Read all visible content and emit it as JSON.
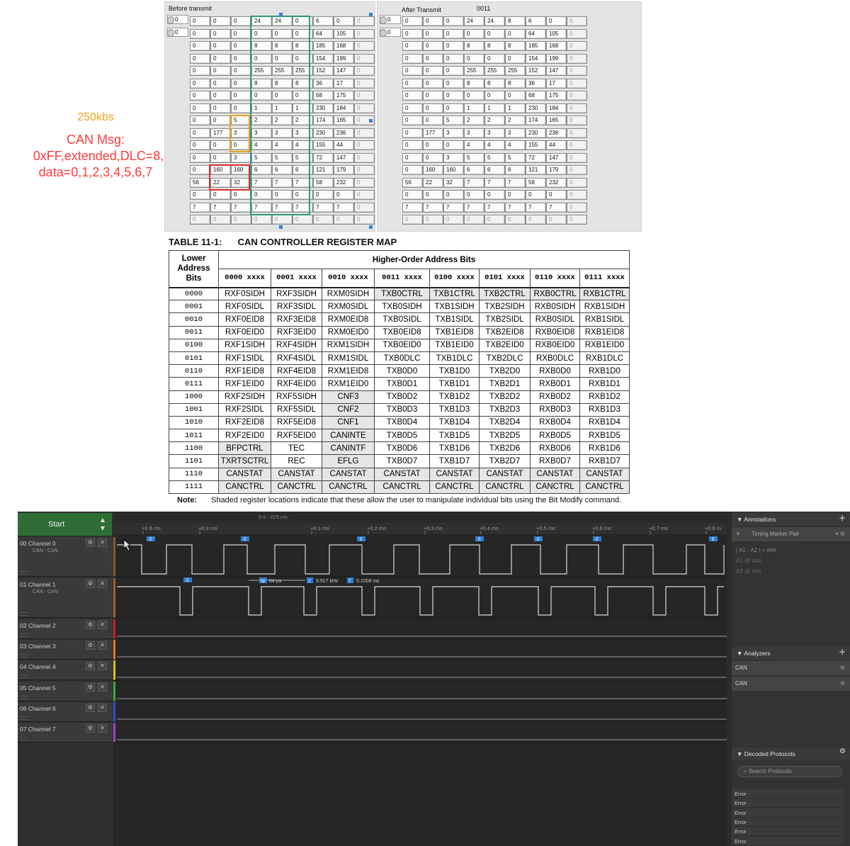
{
  "labview": {
    "before_label": "Before transmit",
    "after_label": "After Transmit",
    "after_extra": "0011",
    "ctl_values": [
      "0",
      "0"
    ],
    "before_rows": [
      [
        "0",
        "0",
        "0",
        "24",
        "24",
        "0",
        "6",
        "0",
        "0"
      ],
      [
        "0",
        "0",
        "0",
        "0",
        "0",
        "0",
        "64",
        "105",
        "0"
      ],
      [
        "0",
        "0",
        "0",
        "8",
        "8",
        "8",
        "185",
        "168",
        "0"
      ],
      [
        "0",
        "0",
        "0",
        "0",
        "0",
        "0",
        "154",
        "199",
        "0"
      ],
      [
        "0",
        "0",
        "0",
        "255",
        "255",
        "255",
        "152",
        "147",
        "0"
      ],
      [
        "0",
        "0",
        "0",
        "8",
        "8",
        "8",
        "36",
        "17",
        "0"
      ],
      [
        "0",
        "0",
        "0",
        "0",
        "0",
        "0",
        "68",
        "175",
        "0"
      ],
      [
        "0",
        "0",
        "0",
        "1",
        "1",
        "1",
        "230",
        "184",
        "0"
      ],
      [
        "0",
        "0",
        "5",
        "2",
        "2",
        "2",
        "174",
        "165",
        "0"
      ],
      [
        "0",
        "177",
        "3",
        "3",
        "3",
        "3",
        "230",
        "236",
        "0"
      ],
      [
        "0",
        "0",
        "0",
        "4",
        "4",
        "4",
        "155",
        "44",
        "0"
      ],
      [
        "0",
        "0",
        "3",
        "5",
        "5",
        "5",
        "72",
        "147",
        "0"
      ],
      [
        "0",
        "160",
        "160",
        "6",
        "6",
        "6",
        "121",
        "179",
        "0"
      ],
      [
        "56",
        "22",
        "32",
        "7",
        "7",
        "7",
        "58",
        "232",
        "0"
      ],
      [
        "0",
        "0",
        "0",
        "0",
        "0",
        "0",
        "0",
        "0",
        "0"
      ],
      [
        "7",
        "7",
        "7",
        "7",
        "7",
        "7",
        "7",
        "7",
        "0"
      ],
      [
        "0",
        "0",
        "0",
        "0",
        "0",
        "0",
        "0",
        "0",
        "0"
      ]
    ],
    "after_rows": [
      [
        "0",
        "0",
        "0",
        "24",
        "24",
        "8",
        "6",
        "0",
        "0"
      ],
      [
        "0",
        "0",
        "0",
        "0",
        "0",
        "0",
        "64",
        "105",
        "0"
      ],
      [
        "0",
        "0",
        "0",
        "8",
        "8",
        "8",
        "185",
        "168",
        "0"
      ],
      [
        "0",
        "0",
        "0",
        "0",
        "0",
        "0",
        "154",
        "199",
        "0"
      ],
      [
        "0",
        "0",
        "0",
        "255",
        "255",
        "255",
        "152",
        "147",
        "0"
      ],
      [
        "0",
        "0",
        "0",
        "8",
        "8",
        "8",
        "36",
        "17",
        "0"
      ],
      [
        "0",
        "0",
        "0",
        "0",
        "0",
        "0",
        "68",
        "175",
        "0"
      ],
      [
        "0",
        "0",
        "0",
        "1",
        "1",
        "1",
        "230",
        "184",
        "0"
      ],
      [
        "0",
        "0",
        "5",
        "2",
        "2",
        "2",
        "174",
        "165",
        "0"
      ],
      [
        "0",
        "177",
        "3",
        "3",
        "3",
        "3",
        "230",
        "236",
        "0"
      ],
      [
        "0",
        "0",
        "0",
        "4",
        "4",
        "4",
        "155",
        "44",
        "0"
      ],
      [
        "0",
        "0",
        "3",
        "5",
        "5",
        "5",
        "72",
        "147",
        "0"
      ],
      [
        "0",
        "160",
        "160",
        "6",
        "6",
        "6",
        "121",
        "179",
        "0"
      ],
      [
        "56",
        "22",
        "32",
        "7",
        "7",
        "7",
        "58",
        "232",
        "0"
      ],
      [
        "0",
        "0",
        "0",
        "0",
        "0",
        "0",
        "0",
        "0",
        "0"
      ],
      [
        "7",
        "7",
        "7",
        "7",
        "7",
        "7",
        "7",
        "7",
        "0"
      ],
      [
        "0",
        "0",
        "0",
        "0",
        "0",
        "0",
        "0",
        "0",
        "0"
      ]
    ]
  },
  "notes": {
    "speed": "250kbs",
    "msg_line1": "CAN Msg:",
    "msg_line2": "0xFF,extended,DLC=8,",
    "msg_line3": "data=0,1,2,3,4,5,6,7"
  },
  "register_map": {
    "table_number": "TABLE 11-1:",
    "title": "CAN CONTROLLER REGISTER MAP",
    "lower_header": "Lower Address Bits",
    "higher_header": "Higher-Order Address Bits",
    "columns": [
      "0000 xxxx",
      "0001 xxxx",
      "0010 xxxx",
      "0011 xxxx",
      "0100 xxxx",
      "0101 xxxx",
      "0110 xxxx",
      "0111 xxxx"
    ],
    "rows": [
      {
        "addr": "0000",
        "cells": [
          "RXF0SIDH",
          "RXF3SIDH",
          "RXM0SIDH",
          "TXB0CTRL",
          "TXB1CTRL",
          "TXB2CTRL",
          "RXB0CTRL",
          "RXB1CTRL"
        ]
      },
      {
        "addr": "0001",
        "cells": [
          "RXF0SIDL",
          "RXF3SIDL",
          "RXM0SIDL",
          "TXB0SIDH",
          "TXB1SIDH",
          "TXB2SIDH",
          "RXB0SIDH",
          "RXB1SIDH"
        ]
      },
      {
        "addr": "0010",
        "cells": [
          "RXF0EID8",
          "RXF3EID8",
          "RXM0EID8",
          "TXB0SIDL",
          "TXB1SIDL",
          "TXB2SIDL",
          "RXB0SIDL",
          "RXB1SIDL"
        ]
      },
      {
        "addr": "0011",
        "cells": [
          "RXF0EID0",
          "RXF3EID0",
          "RXM0EID0",
          "TXB0EID8",
          "TXB1EID8",
          "TXB2EID8",
          "RXB0EID8",
          "RXB1EID8"
        ]
      },
      {
        "addr": "0100",
        "cells": [
          "RXF1SIDH",
          "RXF4SIDH",
          "RXM1SIDH",
          "TXB0EID0",
          "TXB1EID0",
          "TXB2EID0",
          "RXB0EID0",
          "RXB1EID0"
        ]
      },
      {
        "addr": "0101",
        "cells": [
          "RXF1SIDL",
          "RXF4SIDL",
          "RXM1SIDL",
          "TXB0DLC",
          "TXB1DLC",
          "TXB2DLC",
          "RXB0DLC",
          "RXB1DLC"
        ]
      },
      {
        "addr": "0110",
        "cells": [
          "RXF1EID8",
          "RXF4EID8",
          "RXM1EID8",
          "TXB0D0",
          "TXB1D0",
          "TXB2D0",
          "RXB0D0",
          "RXB1D0"
        ]
      },
      {
        "addr": "0111",
        "cells": [
          "RXF1EID0",
          "RXF4EID0",
          "RXM1EID0",
          "TXB0D1",
          "TXB1D1",
          "TXB2D1",
          "RXB0D1",
          "RXB1D1"
        ]
      },
      {
        "addr": "1000",
        "cells": [
          "RXF2SIDH",
          "RXF5SIDH",
          "CNF3",
          "TXB0D2",
          "TXB1D2",
          "TXB2D2",
          "RXB0D2",
          "RXB1D2"
        ]
      },
      {
        "addr": "1001",
        "cells": [
          "RXF2SIDL",
          "RXF5SIDL",
          "CNF2",
          "TXB0D3",
          "TXB1D3",
          "TXB2D3",
          "RXB0D3",
          "RXB1D3"
        ]
      },
      {
        "addr": "1010",
        "cells": [
          "RXF2EID8",
          "RXF5EID8",
          "CNF1",
          "TXB0D4",
          "TXB1D4",
          "TXB2D4",
          "RXB0D4",
          "RXB1D4"
        ]
      },
      {
        "addr": "1011",
        "cells": [
          "RXF2EID0",
          "RXF5EID0",
          "CANINTE",
          "TXB0D5",
          "TXB1D5",
          "TXB2D5",
          "RXB0D5",
          "RXB1D5"
        ]
      },
      {
        "addr": "1100",
        "cells": [
          "BFPCTRL",
          "TEC",
          "CANINTF",
          "TXB0D6",
          "TXB1D6",
          "TXB2D6",
          "RXB0D6",
          "RXB1D6"
        ]
      },
      {
        "addr": "1101",
        "cells": [
          "TXRTSCTRL",
          "REC",
          "EFLG",
          "TXB0D7",
          "TXB1D7",
          "TXB2D7",
          "RXB0D7",
          "RXB1D7"
        ]
      },
      {
        "addr": "1110",
        "cells": [
          "CANSTAT",
          "CANSTAT",
          "CANSTAT",
          "CANSTAT",
          "CANSTAT",
          "CANSTAT",
          "CANSTAT",
          "CANSTAT"
        ]
      },
      {
        "addr": "1111",
        "cells": [
          "CANCTRL",
          "CANCTRL",
          "CANCTRL",
          "CANCTRL",
          "CANCTRL",
          "CANCTRL",
          "CANCTRL",
          "CANCTRL"
        ]
      }
    ],
    "shaded": [
      [
        0,
        3
      ],
      [
        0,
        4
      ],
      [
        0,
        5
      ],
      [
        0,
        6
      ],
      [
        0,
        7
      ],
      [
        8,
        2
      ],
      [
        9,
        2
      ],
      [
        10,
        2
      ],
      [
        11,
        2
      ],
      [
        12,
        0
      ],
      [
        12,
        2
      ],
      [
        13,
        0
      ],
      [
        13,
        2
      ],
      [
        14,
        0
      ],
      [
        14,
        1
      ],
      [
        14,
        2
      ],
      [
        14,
        3
      ],
      [
        14,
        4
      ],
      [
        14,
        5
      ],
      [
        14,
        6
      ],
      [
        14,
        7
      ],
      [
        15,
        0
      ],
      [
        15,
        1
      ],
      [
        15,
        2
      ],
      [
        15,
        3
      ],
      [
        15,
        4
      ],
      [
        15,
        5
      ],
      [
        15,
        6
      ],
      [
        15,
        7
      ]
    ],
    "note_label": "Note:",
    "note_text": "Shaded register locations indicate that these allow the user to manipulate individual bits using the Bit Modify command."
  },
  "analyzer": {
    "start_label": "Start",
    "time_cursor": "0 s : 223 ms",
    "time_ticks": [
      "+0.8 ms",
      "+0.9 ms",
      "+0.1 ms",
      "+0.2 ms",
      "+0.3 ms",
      "+0.4 ms",
      "+0.5 ms",
      "+0.6 ms",
      "+0.7 ms",
      "+0.8 m"
    ],
    "channels": [
      {
        "num": "00",
        "name": "Channel 0",
        "sub": "CAN - CAN",
        "color": "#8a5a2a"
      },
      {
        "num": "01",
        "name": "Channel 1",
        "sub": "CAN - CAN",
        "color": "#a0622a"
      },
      {
        "num": "02",
        "name": "Channel 2",
        "sub": "",
        "color": "#d02020"
      },
      {
        "num": "03",
        "name": "Channel 3",
        "sub": "",
        "color": "#e07a18"
      },
      {
        "num": "04",
        "name": "Channel 4",
        "sub": "",
        "color": "#e0c018"
      },
      {
        "num": "05",
        "name": "Channel 5",
        "sub": "",
        "color": "#40a838"
      },
      {
        "num": "06",
        "name": "Channel 6",
        "sub": "",
        "color": "#3050d0"
      },
      {
        "num": "07",
        "name": "Channel 7",
        "sub": "",
        "color": "#9a40c8"
      }
    ],
    "frame_marker": "E",
    "measure": {
      "w_badge": "W",
      "w_value": "84 µs",
      "f_badge": "f",
      "f_value": "9.917 kHz",
      "t_badge": "T",
      "t_value": "0.1008 ms"
    },
    "annotations_title": "Annotations",
    "timing_pair": "Timing Marker Pair",
    "a1a2": "| A1 - A2 | = ###",
    "a1": "A1  @  ###",
    "a2": "A2  @  ###",
    "analyzers_title": "Analyzers",
    "analyzers": [
      "CAN",
      "CAN"
    ],
    "decoded_title": "Decoded Protocols",
    "search_placeholder": "Search Protocols",
    "decoded_rows": [
      "Error",
      "Error",
      "Error",
      "Error",
      "Error",
      "Error"
    ]
  }
}
